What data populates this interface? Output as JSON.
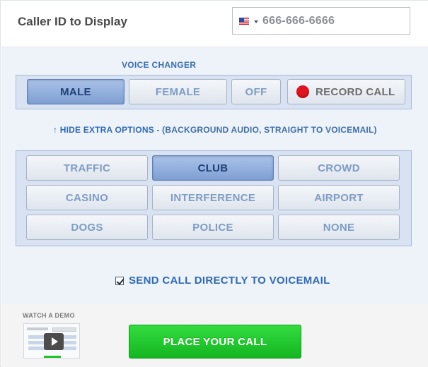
{
  "caller_id": {
    "label": "Caller ID to Display",
    "country_flag_icon": "us-flag-icon",
    "phone_value": "666-666-6666"
  },
  "voice_changer": {
    "title": "VOICE CHANGER",
    "options": [
      {
        "label": "MALE",
        "selected": true
      },
      {
        "label": "FEMALE",
        "selected": false
      },
      {
        "label": "OFF",
        "selected": false
      }
    ],
    "record_label": "RECORD CALL",
    "record_color": "#e0141e"
  },
  "extra_options": {
    "toggle_label": "↑ HIDE EXTRA OPTIONS",
    "note": " - (BACKGROUND AUDIO, STRAIGHT TO VOICEMAIL)"
  },
  "background_audio": {
    "options": [
      {
        "label": "TRAFFIC",
        "selected": false
      },
      {
        "label": "CLUB",
        "selected": true
      },
      {
        "label": "CROWD",
        "selected": false
      },
      {
        "label": "CASINO",
        "selected": false
      },
      {
        "label": "INTERFERENCE",
        "selected": false
      },
      {
        "label": "AIRPORT",
        "selected": false
      },
      {
        "label": "DOGS",
        "selected": false
      },
      {
        "label": "POLICE",
        "selected": false
      },
      {
        "label": "NONE",
        "selected": false
      }
    ]
  },
  "voicemail": {
    "label": "SEND CALL DIRECTLY TO VOICEMAIL",
    "checked": true
  },
  "demo": {
    "label": "WATCH A DEMO"
  },
  "place_call": {
    "label": "PLACE YOUR CALL",
    "color": "#1fc52b"
  },
  "colors": {
    "accent_blue": "#2f6ab2",
    "panel_bg": "#eef2f9",
    "selected_button": "#8fadd9"
  }
}
